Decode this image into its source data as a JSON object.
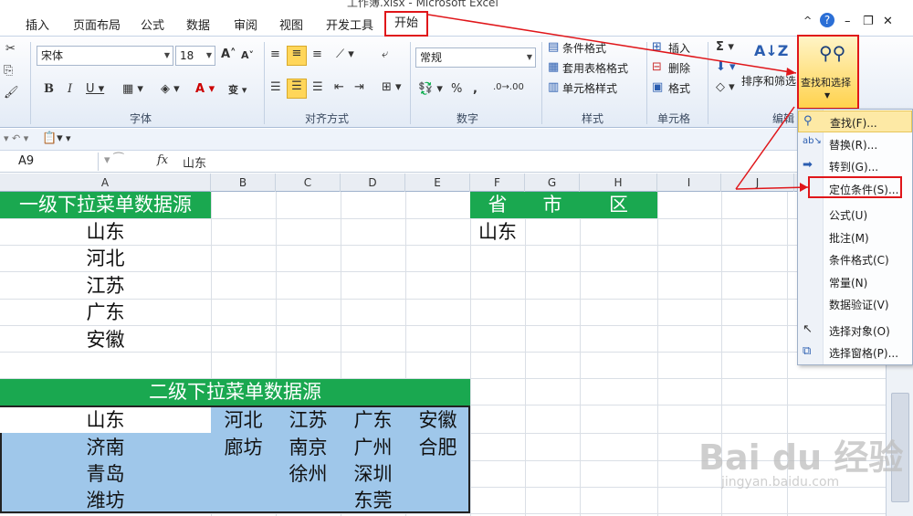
{
  "window": {
    "title": "工作簿.xlsx - Microsoft Excel"
  },
  "tabs": [
    "插入",
    "页面布局",
    "公式",
    "数据",
    "审阅",
    "视图",
    "开发工具"
  ],
  "active_tab": "开始",
  "window_controls": [
    "^",
    "?",
    "–",
    "❐",
    "✕"
  ],
  "ribbon": {
    "font_name": "宋体",
    "font_size": "18",
    "number_format": "常规",
    "groups": [
      "字体",
      "对齐方式",
      "数字",
      "样式",
      "单元格",
      "编辑"
    ],
    "styles": {
      "conditional": "条件格式",
      "table": "套用表格格式",
      "cell_style": "单元格样式"
    },
    "cells": {
      "insert": "插入",
      "delete": "删除",
      "format": "格式"
    },
    "edit": {
      "sort": "排序和筛选",
      "find": "查找和选择"
    }
  },
  "formula_bar": {
    "name_box": "A9",
    "fx": "fx",
    "value": "山东"
  },
  "columns": [
    "A",
    "B",
    "C",
    "D",
    "E",
    "F",
    "G",
    "H",
    "I",
    "J"
  ],
  "sheet": {
    "header1": "一级下拉菜单数据源",
    "provinces": [
      "山东",
      "河北",
      "江苏",
      "广东",
      "安徽"
    ],
    "header2": "二级下拉菜单数据源",
    "table2": [
      [
        "山东",
        "河北",
        "江苏",
        "广东",
        "安徽"
      ],
      [
        "济南",
        "廊坊",
        "南京",
        "广州",
        "合肥"
      ],
      [
        "青岛",
        "",
        "徐州",
        "深圳",
        ""
      ],
      [
        "潍坊",
        "",
        "",
        "东莞",
        ""
      ]
    ],
    "right_headers": [
      "省",
      "市",
      "区"
    ],
    "f_value": "山东"
  },
  "menu": {
    "items": [
      {
        "label": "查找(F)...",
        "icon": "binoculars-icon"
      },
      {
        "label": "替换(R)...",
        "icon": "replace-icon"
      },
      {
        "label": "转到(G)...",
        "icon": "arrow-right-icon"
      },
      {
        "label": "定位条件(S)...",
        "icon": ""
      },
      {
        "label": "公式(U)",
        "icon": ""
      },
      {
        "label": "批注(M)",
        "icon": ""
      },
      {
        "label": "条件格式(C)",
        "icon": ""
      },
      {
        "label": "常量(N)",
        "icon": ""
      },
      {
        "label": "数据验证(V)",
        "icon": ""
      },
      {
        "label": "选择对象(O)",
        "icon": "pointer-icon"
      },
      {
        "label": "选择窗格(P)...",
        "icon": "selection-pane-icon"
      }
    ]
  },
  "watermark": {
    "logo": "Bai du 经验",
    "url": "jingyan.baidu.com"
  }
}
